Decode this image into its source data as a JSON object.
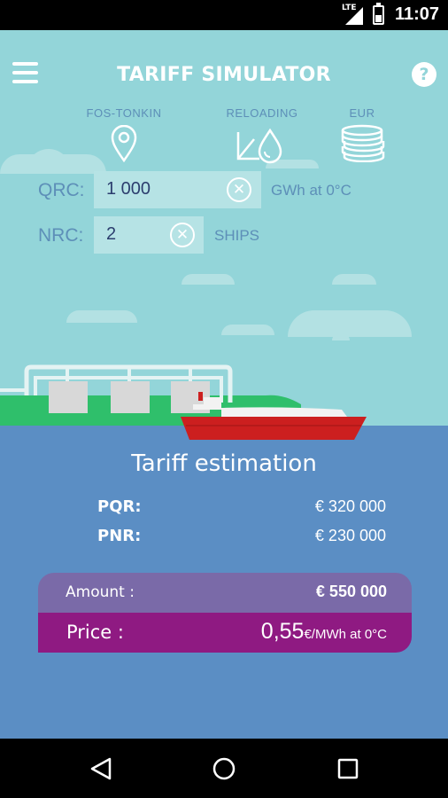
{
  "status_bar": {
    "time": "11:07",
    "network": "LTE"
  },
  "app_bar": {
    "title": "TARIFF SIMULATOR",
    "menu_icon": "hamburger-menu-icon",
    "help_icon": "help-icon",
    "help_glyph": "?"
  },
  "options": [
    {
      "label": "FOS-TONKIN",
      "icon": "location-pin-icon"
    },
    {
      "label": "RELOADING",
      "icon": "reloading-icon"
    },
    {
      "label": "EUR",
      "icon": "coin-stack-icon"
    }
  ],
  "inputs": {
    "qrc": {
      "label": "QRC:",
      "value": "1 000",
      "unit": "GWh at 0°C",
      "clear_glyph": "✕"
    },
    "nrc": {
      "label": "NRC:",
      "value": "2",
      "unit": "SHIPS",
      "clear_glyph": "✕"
    }
  },
  "tariff": {
    "title": "Tariff estimation",
    "rows": [
      {
        "label": "PQR:",
        "value": "€ 320 000"
      },
      {
        "label": "PNR:",
        "value": "€ 230 000"
      }
    ],
    "amount_label": "Amount :",
    "amount_value": "€ 550 000",
    "price_label": "Price :",
    "price_value": "0,55",
    "price_unit": "€/MWh at 0°C"
  },
  "colors": {
    "sky": "#93d5d9",
    "sea": "#5b8ec4",
    "amount_bg": "#7a6aa8",
    "price_bg": "#8f1a82",
    "ship": "#cc1f1f",
    "land": "#2fbf6b"
  },
  "nav_bar": {
    "back_icon": "back-triangle-icon",
    "home_icon": "home-circle-icon",
    "recents_icon": "recents-square-icon"
  }
}
